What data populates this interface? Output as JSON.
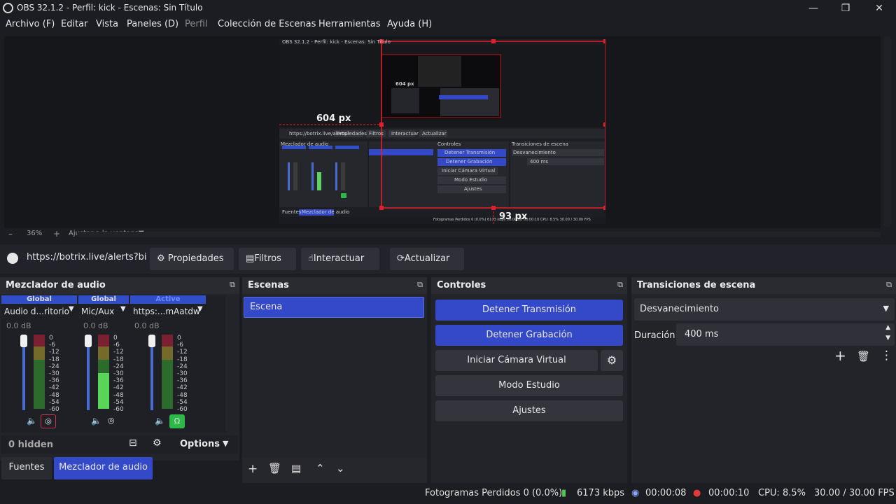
{
  "app": {
    "title": "OBS 32.1.2 - Perfil: kick - Escenas: Sin Título"
  },
  "menu": [
    "Archivo (F)",
    "Editar",
    "Vista",
    "Paneles (D)",
    "Perfil",
    "Colección de Escenas",
    "Herramientas",
    "Ayuda (H)"
  ],
  "preview": {
    "zoom": "36%",
    "fit_label": "Ajustar a la ventana",
    "label_width": "604 px",
    "label_bottom": "93 px"
  },
  "source_toolbar": {
    "url": "https://botrix.live/alerts?bi",
    "props": "Propiedades",
    "filters": "Filtros",
    "interact": "Interactuar",
    "refresh": "Actualizar"
  },
  "mixer": {
    "title": "Mezclador de audio",
    "channels": [
      {
        "tag": "Global",
        "name": "Audio d...ritorio",
        "db": "0.0 dB",
        "level": 0.9
      },
      {
        "tag": "Global",
        "name": "Mic/Aux",
        "db": "0.0 dB",
        "level": 0.9
      },
      {
        "tag": "Active",
        "name": "https:...mAatdw",
        "db": "0.0 dB",
        "level": 0.9
      }
    ],
    "scale": [
      "0",
      "-6",
      "-12",
      "-18",
      "-24",
      "-30",
      "-36",
      "-42",
      "-48",
      "-54",
      "-60"
    ],
    "hidden": "0 hidden",
    "options": "Options"
  },
  "tabs": {
    "sources": "Fuentes",
    "mixer": "Mezclador de audio"
  },
  "scenes": {
    "title": "Escenas",
    "items": [
      "Escena"
    ]
  },
  "controls": {
    "title": "Controles",
    "stop_stream": "Detener Transmisión",
    "stop_rec": "Detener Grabación",
    "virtual_cam": "Iniciar Cámara Virtual",
    "studio": "Modo Estudio",
    "settings": "Ajustes"
  },
  "transitions": {
    "title": "Transiciones de escena",
    "selected": "Desvanecimiento",
    "duration_label": "Duración",
    "duration": "400 ms"
  },
  "status": {
    "dropped": "Fotogramas Perdidos 0 (0.0%)",
    "kbps": "6173 kbps",
    "stream_time": "00:00:08",
    "rec_time": "00:00:10",
    "cpu": "CPU: 8.5%",
    "fps": "30.00 / 30.00 FPS"
  },
  "nested_preview": {
    "title": "OBS 32.1.2 - Perfil: kick - Escenas: Sin Título",
    "sources_bar": [
      "https://botrix.live/alerts?",
      "Propiedades",
      "Filtros",
      "Interactuar",
      "Actualizar"
    ],
    "mixer_title": "Mezclador de audio",
    "controls_title": "Controles",
    "controls": [
      "Detener Transmisión",
      "Detener Grabación",
      "Iniciar Cámara Virtual",
      "Modo Estudio",
      "Ajustes"
    ],
    "transitions_title": "Transiciones de escena",
    "transition": "Desvanecimiento",
    "duration": "400 ms",
    "label_inner": "604 px",
    "tabs": [
      "Fuentes",
      "Mezclador de audio"
    ],
    "status": "Fotogramas Perdidos 0 (0.0%)   6173 kbps   00:00:08   00:00:10   CPU: 8.5%   30.00 / 30.00 FPS"
  }
}
